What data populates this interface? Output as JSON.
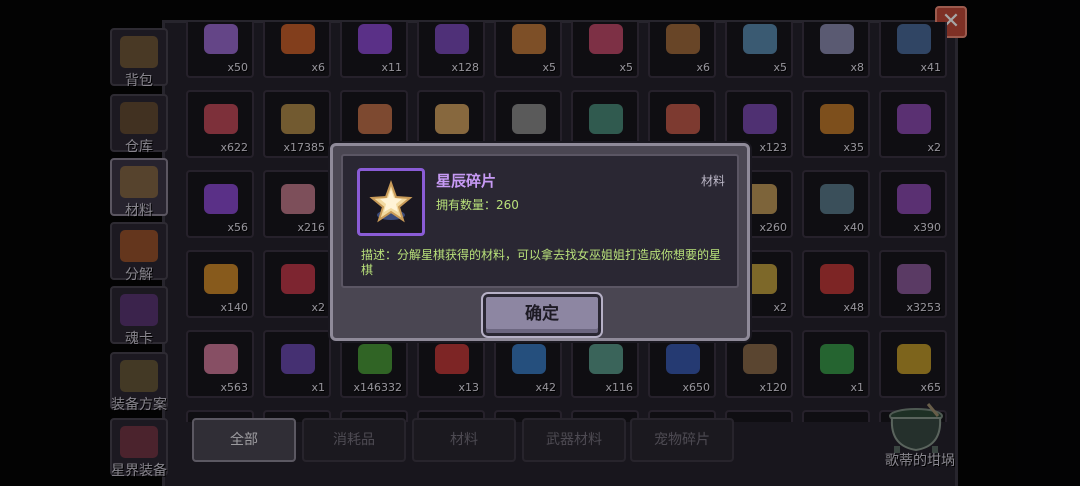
{
  "sidebar": {
    "items": [
      {
        "label": "背包",
        "color": "#8a6a3c"
      },
      {
        "label": "仓库",
        "color": "#7a5a34"
      },
      {
        "label": "材料",
        "color": "#9c7a46",
        "active": true
      },
      {
        "label": "分解",
        "color": "#c0642c"
      },
      {
        "label": "魂卡",
        "color": "#6c3c8c"
      },
      {
        "label": "装备方案",
        "color": "#7c6a3c"
      },
      {
        "label": "星界装备",
        "color": "#8c3c4c"
      }
    ]
  },
  "close_label": "✕",
  "grid": {
    "rows": [
      [
        {
          "count": "x50",
          "color": "#9a6ad0"
        },
        {
          "count": "x6",
          "color": "#c8602c"
        },
        {
          "count": "x11",
          "color": "#8a4ad0"
        },
        {
          "count": "x128",
          "color": "#7a4ab8"
        },
        {
          "count": "x5",
          "color": "#c07a3c"
        },
        {
          "count": "x5",
          "color": "#c04a6a"
        },
        {
          "count": "x6",
          "color": "#a06a3c"
        },
        {
          "count": "x5",
          "color": "#5a8ab0"
        },
        {
          "count": "x8",
          "color": "#8a8ab0"
        },
        {
          "count": "x41",
          "color": "#4a6a9a"
        }
      ],
      [
        {
          "count": "x622",
          "color": "#c04a5a"
        },
        {
          "count": "x17385",
          "color": "#b08a4a"
        },
        {
          "count": "",
          "color": "#c0704a"
        },
        {
          "count": "",
          "color": "#d0a060"
        },
        {
          "count": "",
          "color": "#8a8a8a"
        },
        {
          "count": "",
          "color": "#4a8a7a"
        },
        {
          "count": "",
          "color": "#c05a4a"
        },
        {
          "count": "x123",
          "color": "#7a4ab0"
        },
        {
          "count": "x35",
          "color": "#c07a2c"
        },
        {
          "count": "x2",
          "color": "#8a4ab0"
        }
      ],
      [
        {
          "count": "x56",
          "color": "#8a4ad0"
        },
        {
          "count": "x216",
          "color": "#c07a8a"
        },
        {
          "count": "",
          "color": "#6a6a6a"
        },
        {
          "count": "",
          "color": "#6a6a6a"
        },
        {
          "count": "",
          "color": "#6a6a6a"
        },
        {
          "count": "",
          "color": "#6a6a6a"
        },
        {
          "count": "",
          "color": "#6a6a6a"
        },
        {
          "count": "x260",
          "color": "#c09a5a"
        },
        {
          "count": "x40",
          "color": "#5a7a8a"
        },
        {
          "count": "x390",
          "color": "#8a4ab0"
        }
      ],
      [
        {
          "count": "x140",
          "color": "#d08a2c"
        },
        {
          "count": "x2",
          "color": "#c03a4a"
        },
        {
          "count": "",
          "color": "#6a6a6a"
        },
        {
          "count": "",
          "color": "#6a6a6a"
        },
        {
          "count": "",
          "color": "#6a6a6a"
        },
        {
          "count": "",
          "color": "#6a6a6a"
        },
        {
          "count": "",
          "color": "#6a6a6a"
        },
        {
          "count": "x2",
          "color": "#c0a040"
        },
        {
          "count": "x48",
          "color": "#c03a3a"
        },
        {
          "count": "x3253",
          "color": "#8a5a9a"
        }
      ],
      [
        {
          "count": "x563",
          "color": "#d07a9a"
        },
        {
          "count": "x1",
          "color": "#6a4ab0"
        },
        {
          "count": "x146332",
          "color": "#4a9a3a"
        },
        {
          "count": "x13",
          "color": "#c03a3a"
        },
        {
          "count": "x42",
          "color": "#3a7ac0"
        },
        {
          "count": "x116",
          "color": "#5a9a8a"
        },
        {
          "count": "x650",
          "color": "#3a5ab0"
        },
        {
          "count": "x120",
          "color": "#8a6a4a"
        },
        {
          "count": "x1",
          "color": "#3a9a4a"
        },
        {
          "count": "x65",
          "color": "#c09a2c"
        }
      ]
    ]
  },
  "tabs": [
    {
      "label": "全部",
      "active": true
    },
    {
      "label": "消耗品"
    },
    {
      "label": "材料"
    },
    {
      "label": "武器材料"
    },
    {
      "label": "宠物碎片"
    }
  ],
  "cauldron_label": "歌蒂的坩埚",
  "dialog": {
    "item_name": "星辰碎片",
    "item_type": "材料",
    "qty_label": "拥有数量：",
    "qty_value": "260",
    "description": "描述：分解星棋获得的材料，可以拿去找女巫姐姐打造成你想要的星棋",
    "confirm_label": "确定",
    "border_color": "#8a5cd6"
  }
}
